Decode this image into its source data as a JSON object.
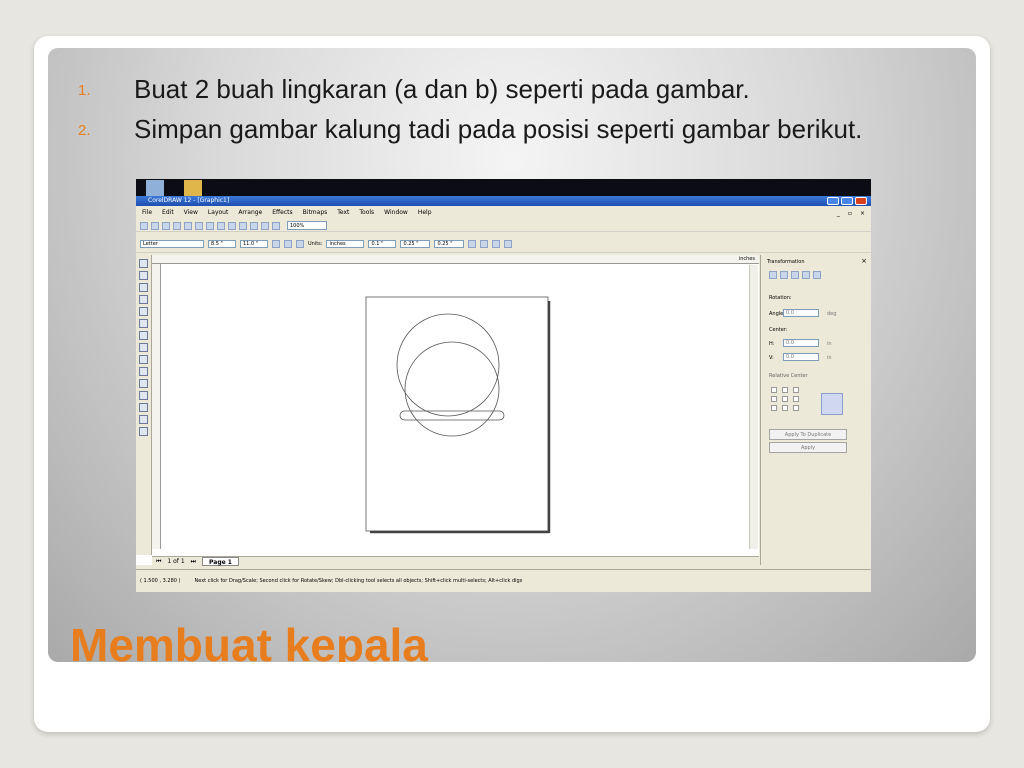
{
  "slide": {
    "bullets": [
      {
        "num": "1.",
        "text": "Buat 2 buah lingkaran (a dan b) seperti pada gambar."
      },
      {
        "num": "2.",
        "text": "Simpan gambar kalung tadi pada posisi seperti gambar berikut."
      }
    ],
    "title": "Membuat kepala"
  },
  "app": {
    "window_title": "CorelDRAW 12 - [Graphic1]",
    "menu": [
      "File",
      "Edit",
      "View",
      "Layout",
      "Arrange",
      "Effects",
      "Bitmaps",
      "Text",
      "Tools",
      "Window",
      "Help"
    ],
    "zoom": "100%",
    "property_bar": {
      "paper": "Letter",
      "width": "8.5 \"",
      "height": "11.0 \"",
      "units_label": "Units:",
      "units": "inches",
      "nudge": "0.1 \"",
      "dup_x": "0.25 \"",
      "dup_y": "0.25 \""
    },
    "ruler_unit": "inches",
    "page_nav": {
      "count": "1 of 1",
      "tab": "Page 1"
    },
    "status": {
      "coords": "( 1.500 , 3.280 )",
      "hint": "Next click for Drag/Scale; Second click for Rotate/Skew; Dbl-clicking tool selects all objects; Shift+click multi-selects; Alt+click digs"
    },
    "docker": {
      "title": "Transformation",
      "rotation_label": "Rotation:",
      "angle_label": "Angle:",
      "angle_value": "0.0",
      "angle_unit": "deg",
      "center_label": "Center:",
      "h_label": "H:",
      "h_value": "0.0",
      "v_label": "V:",
      "v_value": "0.0",
      "in_unit": "in",
      "relative_center": "Relative Center",
      "apply_dup": "Apply To Duplicate",
      "apply": "Apply"
    }
  }
}
